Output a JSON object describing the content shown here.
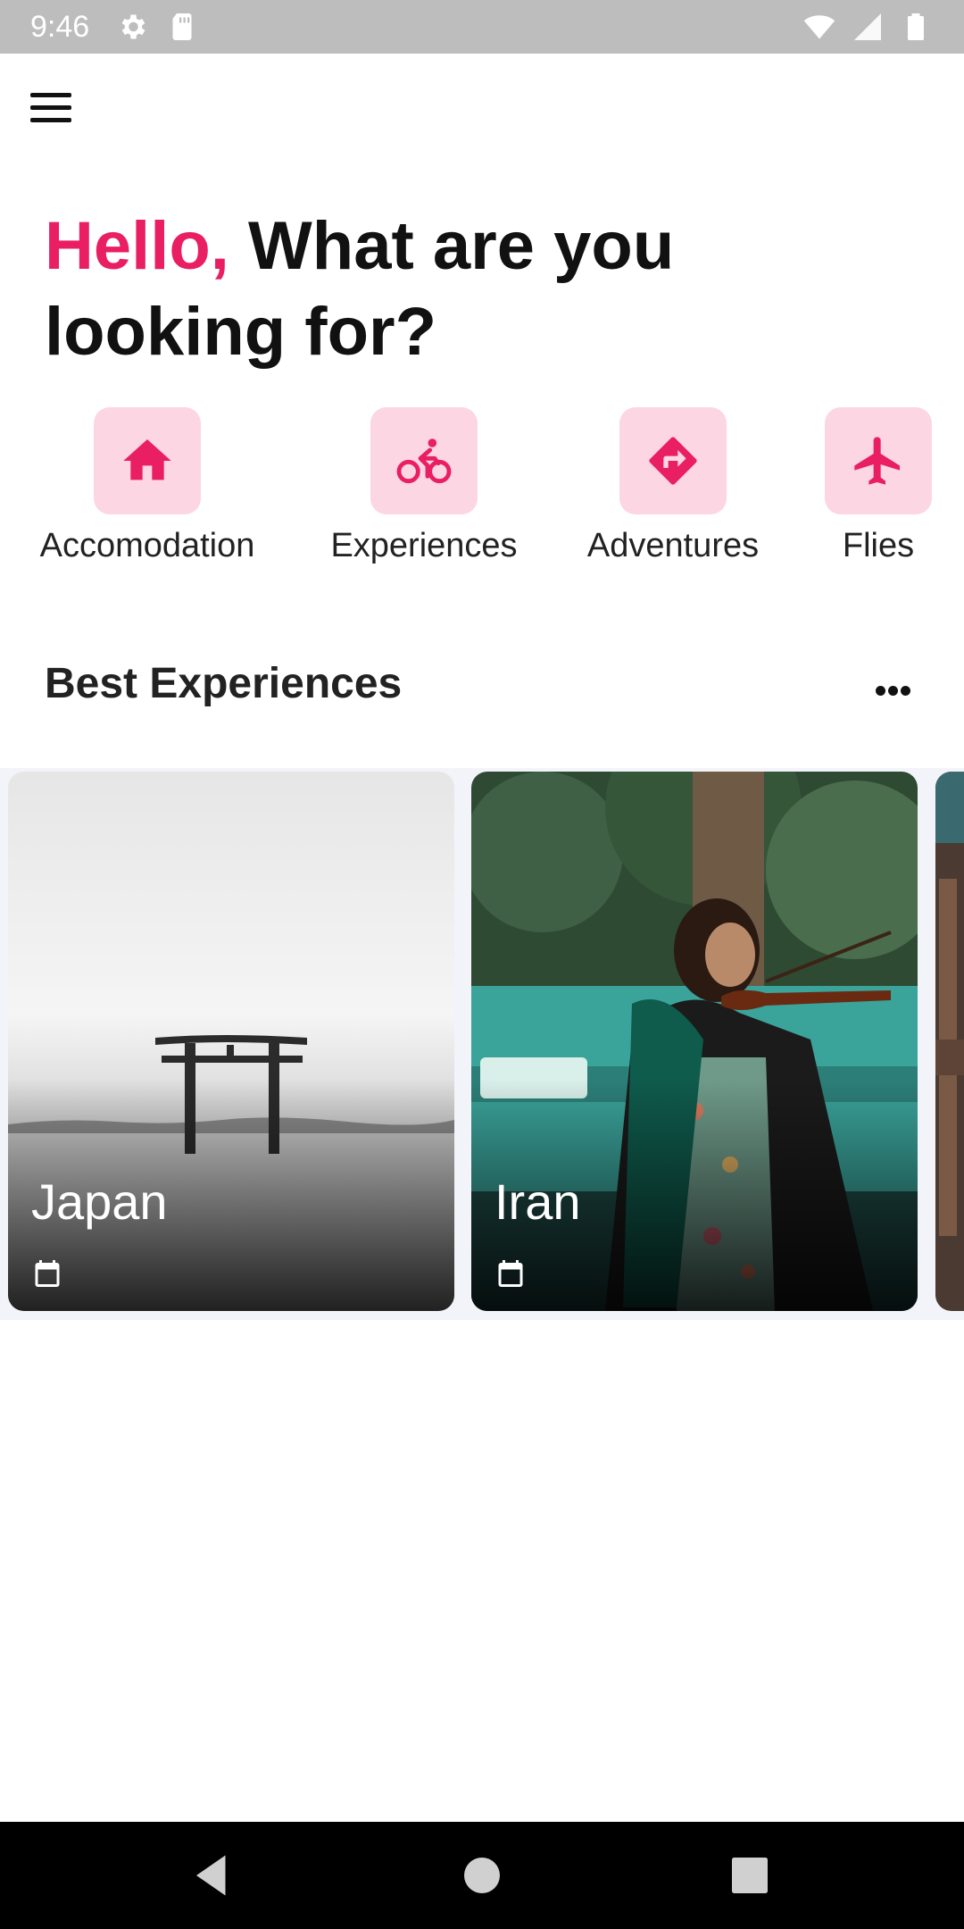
{
  "status_bar": {
    "time": "9:46",
    "left_icons": [
      "settings-icon",
      "sd-card-icon"
    ],
    "right_icons": [
      "wifi-icon",
      "signal-icon",
      "battery-icon"
    ]
  },
  "greeting": {
    "hello": "Hello,",
    "rest": "What are you looking for?",
    "accent_color": "#e91e63"
  },
  "categories": [
    {
      "label": "Accomodation",
      "icon": "home-icon"
    },
    {
      "label": "Experiences",
      "icon": "bicycle-icon"
    },
    {
      "label": "Adventures",
      "icon": "directions-icon"
    },
    {
      "label": "Flies",
      "icon": "airplane-icon"
    }
  ],
  "section": {
    "title": "Best Experiences",
    "more_icon": "more-horizontal-icon"
  },
  "cards": [
    {
      "title": "Japan",
      "icon": "calendar-icon"
    },
    {
      "title": "Iran",
      "icon": "calendar-icon"
    }
  ],
  "colors": {
    "accent": "#e91e63",
    "category_tile": "#fcd6e3"
  },
  "nav_bar": [
    "back-icon",
    "home-circle-icon",
    "recents-icon"
  ]
}
